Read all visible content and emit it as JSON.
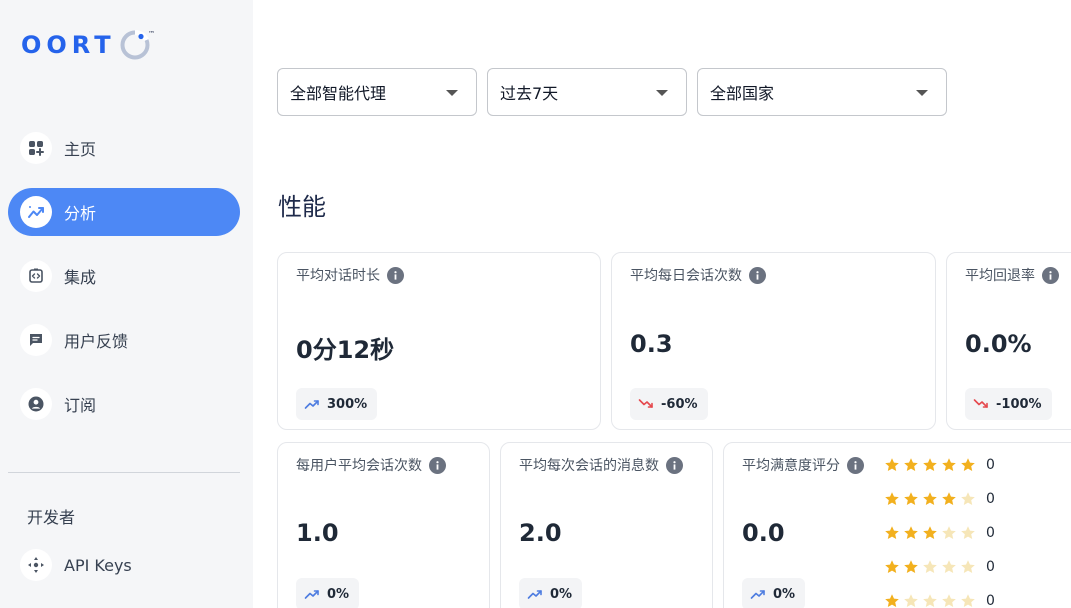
{
  "brand": {
    "logo_text": "OORT",
    "trademark": "™",
    "accent": "#2563eb"
  },
  "sidebar": {
    "items": [
      {
        "label": "主页",
        "icon": "home-grid-icon",
        "active": false
      },
      {
        "label": "分析",
        "icon": "analytics-trend-icon",
        "active": true
      },
      {
        "label": "集成",
        "icon": "integration-code-icon",
        "active": false
      },
      {
        "label": "用户反馈",
        "icon": "feedback-chat-icon",
        "active": false
      },
      {
        "label": "订阅",
        "icon": "subscription-user-icon",
        "active": false
      }
    ],
    "developer_section": "开发者",
    "developer_items": [
      {
        "label": "API Keys",
        "icon": "api-keys-icon"
      }
    ]
  },
  "filters": {
    "agent": "全部智能代理",
    "period": "过去7天",
    "country": "全部国家"
  },
  "performance": {
    "title": "性能",
    "cards": [
      {
        "title": "平均对话时长",
        "value": "0分12秒",
        "trend": "300%",
        "direction": "up"
      },
      {
        "title": "平均每日会话次数",
        "value": "0.3",
        "trend": "-60%",
        "direction": "down"
      },
      {
        "title": "平均回退率",
        "value": "0.0%",
        "trend": "-100%",
        "direction": "down"
      },
      {
        "title": "每用户平均会话次数",
        "value": "1.0",
        "trend": "0%",
        "direction": "up"
      },
      {
        "title": "平均每次会话的消息数",
        "value": "2.0",
        "trend": "0%",
        "direction": "up"
      },
      {
        "title": "平均满意度评分",
        "value": "0.0",
        "trend": "0%",
        "direction": "up"
      }
    ],
    "rating_breakdown": [
      {
        "stars": 5,
        "count": "0"
      },
      {
        "stars": 4,
        "count": "0"
      },
      {
        "stars": 3,
        "count": "0"
      },
      {
        "stars": 2,
        "count": "0"
      },
      {
        "stars": 1,
        "count": "0"
      }
    ]
  },
  "colors": {
    "active_nav": "#4d88f5",
    "up": "#4d7ce0",
    "down": "#e5484d",
    "star": "#f2b01e",
    "star_empty": "#f6e6b8"
  }
}
